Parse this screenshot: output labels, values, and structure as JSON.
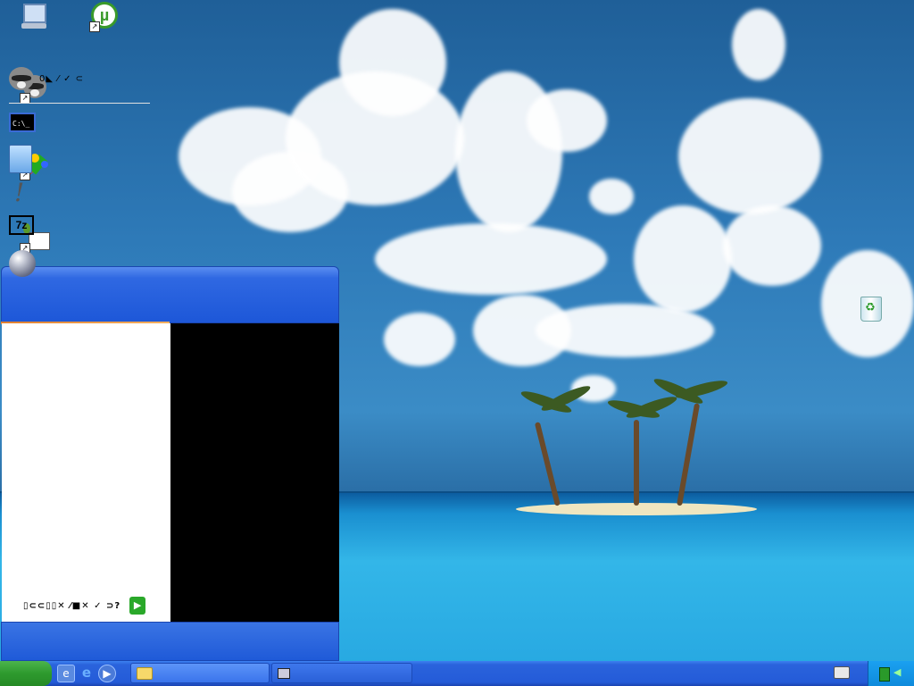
{
  "desktop": {
    "icons": [
      {
        "id": "my-computer"
      },
      {
        "id": "utorrent",
        "glyph": "µ"
      },
      {
        "id": "raccoon-app"
      },
      {
        "id": "colors-app"
      },
      {
        "id": "network-app"
      },
      {
        "id": "recycle-bin",
        "glyph": "♻"
      }
    ]
  },
  "start_menu": {
    "pinned_user_label": "0◣ ⁄ ✓ ⊂",
    "programs": [
      {
        "name": "cmd",
        "glyph": "C:\\_"
      },
      {
        "name": "notepad"
      },
      {
        "name": "exclaim",
        "glyph": "!"
      },
      {
        "name": "7zip",
        "glyph": "7z"
      },
      {
        "name": "orb"
      }
    ],
    "all_programs_label": "▯⊂⊂▯▯✕ ⁄■✕ ✓ ⊃?",
    "all_programs_arrow": "▶"
  },
  "taskbar": {
    "quick_launch": [
      {
        "name": "show-desktop",
        "glyph": "e"
      },
      {
        "name": "internet-explorer",
        "glyph": "e"
      },
      {
        "name": "media-player",
        "glyph": "▶"
      }
    ],
    "tasks": [
      {
        "name": "explorer-window"
      },
      {
        "name": "terminal-window"
      }
    ],
    "tray": {
      "volume_glyph": "◀"
    }
  },
  "colors": {
    "taskbar_blue": "#245bd8",
    "start_green": "#2e9a2e",
    "menu_header_blue": "#1d57d8",
    "menu_orange": "#e08030"
  }
}
